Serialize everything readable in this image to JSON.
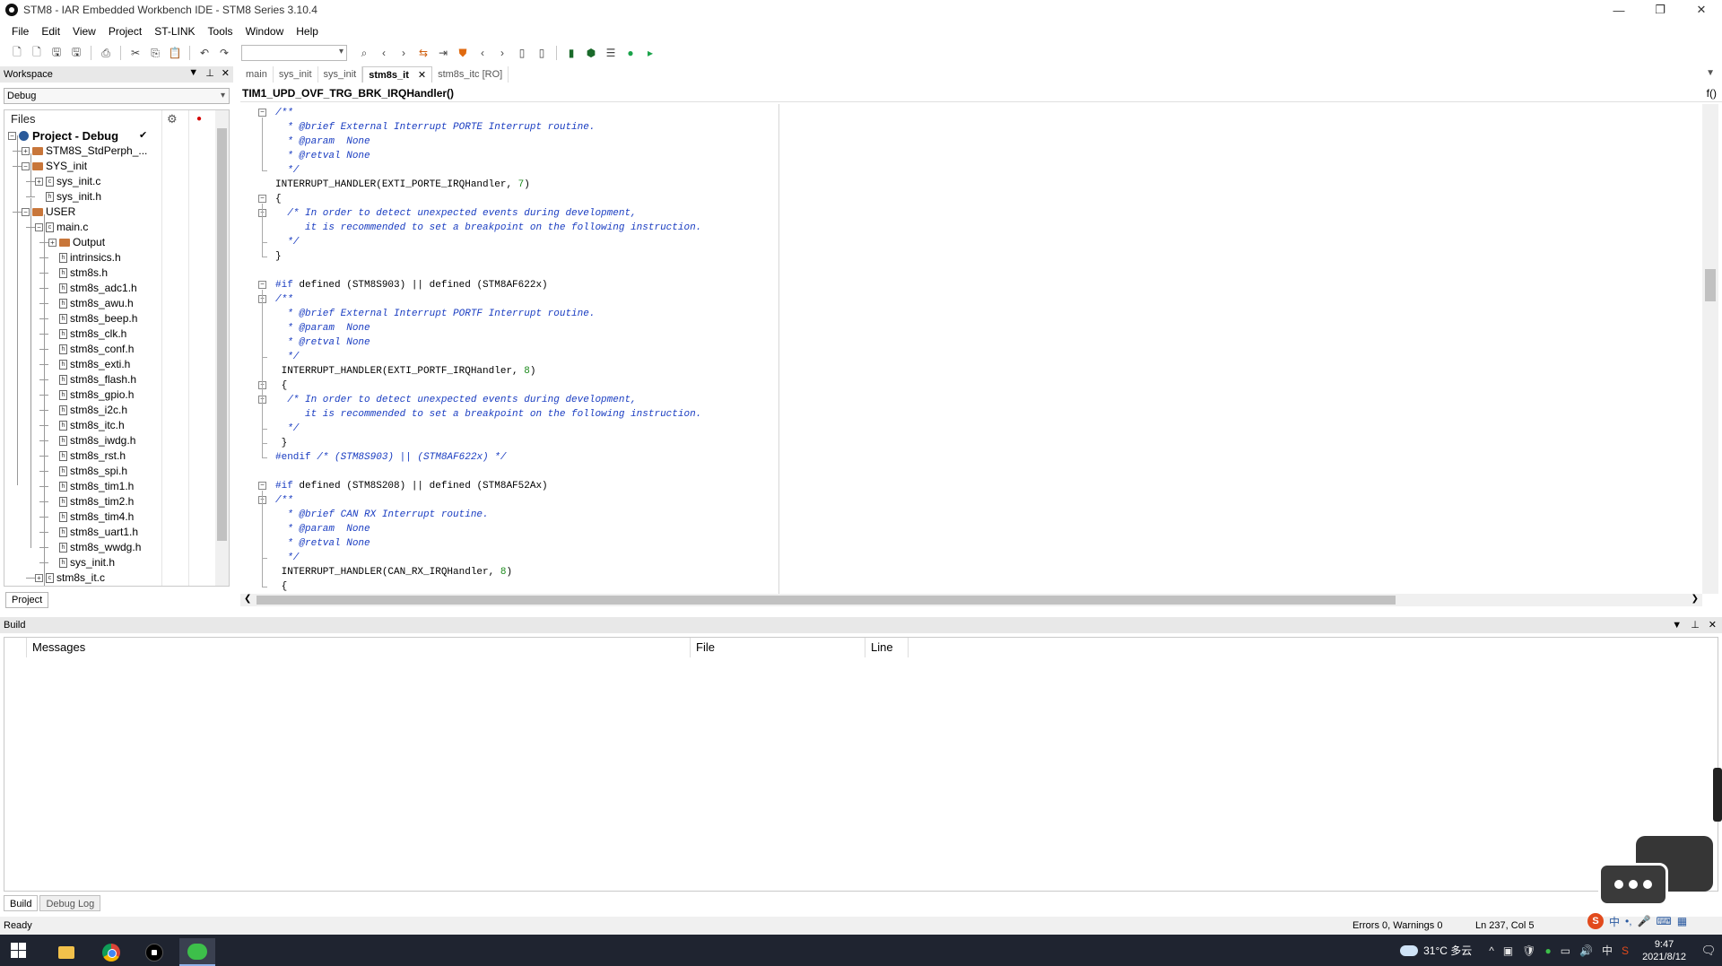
{
  "window": {
    "title": "STM8 - IAR Embedded Workbench IDE - STM8 Series 3.10.4",
    "controls": [
      "—",
      "❐",
      "✕"
    ]
  },
  "menu": [
    "File",
    "Edit",
    "View",
    "Project",
    "ST-LINK",
    "Tools",
    "Window",
    "Help"
  ],
  "workspace": {
    "header": "Workspace",
    "configuration": "Debug",
    "files_label": "Files",
    "project_tab": "Project",
    "tree": [
      {
        "label": "Project - Debug",
        "level": 0,
        "kind": "project",
        "toggle": "−",
        "check": "✔"
      },
      {
        "label": "STM8S_StdPerph_...",
        "level": 1,
        "kind": "folder",
        "toggle": "+"
      },
      {
        "label": "SYS_init",
        "level": 1,
        "kind": "folder",
        "toggle": "−"
      },
      {
        "label": "sys_init.c",
        "level": 2,
        "kind": "cfile",
        "toggle": "+"
      },
      {
        "label": "sys_init.h",
        "level": 2,
        "kind": "hfile",
        "toggle": ""
      },
      {
        "label": "USER",
        "level": 1,
        "kind": "folder",
        "toggle": "−"
      },
      {
        "label": "main.c",
        "level": 2,
        "kind": "cfile",
        "toggle": "−"
      },
      {
        "label": "Output",
        "level": 3,
        "kind": "folder",
        "toggle": "+"
      },
      {
        "label": "intrinsics.h",
        "level": 3,
        "kind": "hfile",
        "toggle": ""
      },
      {
        "label": "stm8s.h",
        "level": 3,
        "kind": "hfile",
        "toggle": ""
      },
      {
        "label": "stm8s_adc1.h",
        "level": 3,
        "kind": "hfile",
        "toggle": ""
      },
      {
        "label": "stm8s_awu.h",
        "level": 3,
        "kind": "hfile",
        "toggle": ""
      },
      {
        "label": "stm8s_beep.h",
        "level": 3,
        "kind": "hfile",
        "toggle": ""
      },
      {
        "label": "stm8s_clk.h",
        "level": 3,
        "kind": "hfile",
        "toggle": ""
      },
      {
        "label": "stm8s_conf.h",
        "level": 3,
        "kind": "hfile",
        "toggle": ""
      },
      {
        "label": "stm8s_exti.h",
        "level": 3,
        "kind": "hfile",
        "toggle": ""
      },
      {
        "label": "stm8s_flash.h",
        "level": 3,
        "kind": "hfile",
        "toggle": ""
      },
      {
        "label": "stm8s_gpio.h",
        "level": 3,
        "kind": "hfile",
        "toggle": ""
      },
      {
        "label": "stm8s_i2c.h",
        "level": 3,
        "kind": "hfile",
        "toggle": ""
      },
      {
        "label": "stm8s_itc.h",
        "level": 3,
        "kind": "hfile",
        "toggle": ""
      },
      {
        "label": "stm8s_iwdg.h",
        "level": 3,
        "kind": "hfile",
        "toggle": ""
      },
      {
        "label": "stm8s_rst.h",
        "level": 3,
        "kind": "hfile",
        "toggle": ""
      },
      {
        "label": "stm8s_spi.h",
        "level": 3,
        "kind": "hfile",
        "toggle": ""
      },
      {
        "label": "stm8s_tim1.h",
        "level": 3,
        "kind": "hfile",
        "toggle": ""
      },
      {
        "label": "stm8s_tim2.h",
        "level": 3,
        "kind": "hfile",
        "toggle": ""
      },
      {
        "label": "stm8s_tim4.h",
        "level": 3,
        "kind": "hfile",
        "toggle": ""
      },
      {
        "label": "stm8s_uart1.h",
        "level": 3,
        "kind": "hfile",
        "toggle": ""
      },
      {
        "label": "stm8s_wwdg.h",
        "level": 3,
        "kind": "hfile",
        "toggle": ""
      },
      {
        "label": "sys_init.h",
        "level": 3,
        "kind": "hfile",
        "toggle": ""
      },
      {
        "label": "stm8s_it.c",
        "level": 2,
        "kind": "cfile",
        "toggle": "+"
      }
    ]
  },
  "editor": {
    "tabs": [
      {
        "label": "main",
        "active": false
      },
      {
        "label": "sys_init",
        "active": false
      },
      {
        "label": "sys_init",
        "active": false
      },
      {
        "label": "stm8s_it",
        "active": true
      },
      {
        "label": "stm8s_itc [RO]",
        "active": false
      }
    ],
    "tab_close": "✕",
    "function_bar": "TIM1_UPD_OVF_TRG_BRK_IRQHandler()",
    "function_btn": "f()",
    "lines": [
      {
        "t": "/**",
        "c": "cmt"
      },
      {
        "t": "  * @brief External Interrupt PORTE Interrupt routine.",
        "c": "cmt"
      },
      {
        "t": "  * @param  None",
        "c": "cmt"
      },
      {
        "t": "  * @retval None",
        "c": "cmt"
      },
      {
        "t": "  */",
        "c": "cmt"
      },
      {
        "t": "INTERRUPT_HANDLER(EXTI_PORTE_IRQHandler, ",
        "c": "",
        "n": "7",
        "e": ")"
      },
      {
        "t": "{",
        "c": ""
      },
      {
        "t": "  /* In order to detect unexpected events during development,",
        "c": "cmt"
      },
      {
        "t": "     it is recommended to set a breakpoint on the following instruction.",
        "c": "cmt"
      },
      {
        "t": "  */",
        "c": "cmt"
      },
      {
        "t": "}",
        "c": ""
      },
      {
        "t": "",
        "c": ""
      },
      {
        "t": "#if",
        "c": "pre",
        "rest": " defined (STM8S903) || defined (STM8AF622x)"
      },
      {
        "t": "/**",
        "c": "cmt"
      },
      {
        "t": "  * @brief External Interrupt PORTF Interrupt routine.",
        "c": "cmt"
      },
      {
        "t": "  * @param  None",
        "c": "cmt"
      },
      {
        "t": "  * @retval None",
        "c": "cmt"
      },
      {
        "t": "  */",
        "c": "cmt"
      },
      {
        "t": " INTERRUPT_HANDLER(EXTI_PORTF_IRQHandler, ",
        "c": "",
        "n": "8",
        "e": ")"
      },
      {
        "t": " {",
        "c": ""
      },
      {
        "t": "  /* In order to detect unexpected events during development,",
        "c": "cmt"
      },
      {
        "t": "     it is recommended to set a breakpoint on the following instruction.",
        "c": "cmt"
      },
      {
        "t": "  */",
        "c": "cmt"
      },
      {
        "t": " }",
        "c": ""
      },
      {
        "t": "#endif",
        "c": "pre",
        "restc": " /* (STM8S903) || (STM8AF622x) */"
      },
      {
        "t": "",
        "c": ""
      },
      {
        "t": "#if",
        "c": "pre",
        "rest": " defined (STM8S208) || defined (STM8AF52Ax)"
      },
      {
        "t": "/**",
        "c": "cmt"
      },
      {
        "t": "  * @brief CAN RX Interrupt routine.",
        "c": "cmt"
      },
      {
        "t": "  * @param  None",
        "c": "cmt"
      },
      {
        "t": "  * @retval None",
        "c": "cmt"
      },
      {
        "t": "  */",
        "c": "cmt"
      },
      {
        "t": " INTERRUPT_HANDLER(CAN_RX_IRQHandler, ",
        "c": "",
        "n": "8",
        "e": ")"
      },
      {
        "t": " {",
        "c": ""
      }
    ]
  },
  "build": {
    "header": "Build",
    "columns": [
      "Messages",
      "File",
      "Line"
    ],
    "tabs": [
      "Build",
      "Debug Log"
    ]
  },
  "status": {
    "left": "Ready",
    "errors": "Errors 0, Warnings 0",
    "position": "Ln 237, Col 5"
  },
  "ime": {
    "logo": "S",
    "items": [
      "中",
      "•,",
      "🎤",
      "⌨",
      "▦"
    ]
  },
  "taskbar": {
    "weather": "31°C  多云",
    "tray_icons": [
      "^",
      "▣",
      "🛡",
      "●",
      "▭",
      "🔊",
      "中"
    ],
    "time": "9:47",
    "date": "2021/8/12",
    "notif": "🗨"
  },
  "colors": {
    "comment": "#1a3dc1",
    "number": "#1b8a1b",
    "taskbar": "#1f2430"
  }
}
